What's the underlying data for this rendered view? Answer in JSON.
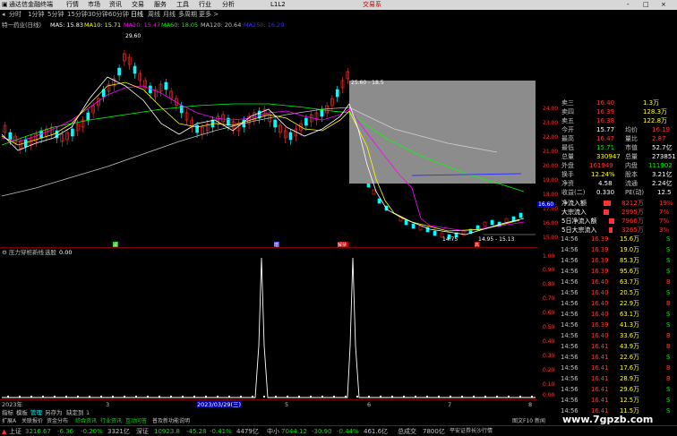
{
  "titlebar": {
    "app_name": "通达信金融终端",
    "menus": [
      "行情",
      "市场",
      "资讯",
      "交易",
      "服务",
      "工具",
      "行业",
      "分析"
    ],
    "title_center": "L1L2",
    "trade_button": "交易系",
    "window_controls": [
      "-",
      "□",
      "×"
    ]
  },
  "menubar": {
    "periods": [
      "分时",
      "1分钟",
      "5分钟",
      "15分钟",
      "30分钟",
      "60分钟",
      "日线",
      "周线",
      "月线",
      "多周期",
      "更多 >"
    ],
    "active_index": 6
  },
  "chart_info": {
    "stock": "特一药业(日线)",
    "ma5": "MA5: 15.83",
    "ma10": "MA10: 15.71",
    "ma20": "MA20: 15.47",
    "ma60": "MA60: 18.05",
    "ma120": "MA120: 20.64",
    "extra": "MA250: 16.29"
  },
  "main_chart": {
    "peak_label": "29.60",
    "range_label": "25.60 - 18.5",
    "low_label1": "14.75",
    "low_label2": "14.95 - 15.13",
    "event_markers": [
      "减",
      "增",
      "解禁",
      "高"
    ],
    "y_ticks": [
      "24.00",
      "23.00",
      "22.00",
      "21.00",
      "20.00",
      "19.00",
      "18.00",
      "17.00",
      "16.00",
      "15.00"
    ],
    "price_box": "16.60"
  },
  "sub_panel": {
    "title": "压力穿桩新线",
    "option": "选股",
    "value": "0.00",
    "y_ticks": [
      "1.00",
      "0.90",
      "0.80",
      "0.70",
      "0.60",
      "0.50",
      "0.40",
      "0.30",
      "0.20",
      "0.10",
      "0.00"
    ]
  },
  "time_axis": {
    "labels": [
      "2023年",
      "3",
      "2023/03/29(三)",
      "5",
      "6",
      "7",
      "8"
    ]
  },
  "tool_row": {
    "items": [
      "指标",
      "模板",
      "管理",
      "另存为",
      "缺定到",
      "1"
    ]
  },
  "bottom_tabs": {
    "items": [
      "扩展A",
      "关联报价",
      "资金分布",
      "综合资讯",
      "行业资讯",
      "互动问答",
      "普及新功能说明"
    ],
    "right_label": "图文F10 新闻"
  },
  "quote": {
    "sell_rows": [
      {
        "label": "卖三",
        "price": "16.40",
        "vol": "1.3万"
      },
      {
        "label": "卖四",
        "price": "16.39",
        "vol": "128.3万"
      },
      {
        "label": "卖五",
        "price": "16.38",
        "vol": "122.8万"
      }
    ],
    "stats": [
      {
        "l1": "今开",
        "v1": "15.77",
        "l2": "均价",
        "v2": "16.19"
      },
      {
        "l1": "最高",
        "v1": "16.47",
        "l2": "量比",
        "v2": "2.87"
      },
      {
        "l1": "最低",
        "v1": "15.71",
        "l2": "市值",
        "v2": "52.7亿"
      },
      {
        "l1": "总量",
        "v1": "330947",
        "l2": "总量",
        "v2": "273851"
      },
      {
        "l1": "外盘",
        "v1": "161949",
        "l2": "内盘",
        "v2": "111902"
      },
      {
        "l1": "换手",
        "v1": "12.24%",
        "l2": "股本",
        "v2": "3.21亿"
      },
      {
        "l1": "净资",
        "v1": "4.58",
        "l2": "流通",
        "v2": "2.24亿"
      },
      {
        "l1": "收益(二)",
        "v1": "0.330",
        "l2": "PE(动)",
        "v2": "12.5"
      }
    ],
    "flows": [
      {
        "label": "净流入额",
        "value": "8212万",
        "pct": "19%"
      },
      {
        "label": "大宗流入",
        "value": "2995万",
        "pct": "7%"
      },
      {
        "label": "5日净流入额",
        "value": "7966万",
        "pct": "7%"
      },
      {
        "label": "5日大宗流入",
        "value": "3265万",
        "pct": "3%"
      }
    ],
    "ticks": [
      {
        "time": "14:56",
        "price": "16.39",
        "vol": "15.6万",
        "flag": "S"
      },
      {
        "time": "14:56",
        "price": "16.39",
        "vol": "19.0万",
        "flag": "S"
      },
      {
        "time": "14:56",
        "price": "16.39",
        "vol": "85.3万",
        "flag": "S"
      },
      {
        "time": "14:56",
        "price": "16.39",
        "vol": "95.6万",
        "flag": "S"
      },
      {
        "time": "14:56",
        "price": "16.40",
        "vol": "63.7万",
        "flag": "B"
      },
      {
        "time": "14:56",
        "price": "16.40",
        "vol": "20.5万",
        "flag": "S"
      },
      {
        "time": "14:56",
        "price": "16.40",
        "vol": "22.9万",
        "flag": "B"
      },
      {
        "time": "14:56",
        "price": "16.40",
        "vol": "63.1万",
        "flag": "S"
      },
      {
        "time": "14:56",
        "price": "16.39",
        "vol": "41.3万",
        "flag": "S"
      },
      {
        "time": "14:56",
        "price": "16.40",
        "vol": "33.6万",
        "flag": "B"
      },
      {
        "time": "14:56",
        "price": "16.41",
        "vol": "43.9万",
        "flag": "B"
      },
      {
        "time": "14:56",
        "price": "16.41",
        "vol": "22.6万",
        "flag": "S"
      },
      {
        "time": "14:56",
        "price": "16.41",
        "vol": "17.6万",
        "flag": "B"
      },
      {
        "time": "14:56",
        "price": "16.41",
        "vol": "28.9万",
        "flag": "B"
      },
      {
        "time": "14:56",
        "price": "16.41",
        "vol": "29.6万",
        "flag": "S"
      },
      {
        "time": "14:56",
        "price": "16.41",
        "vol": "12.5万",
        "flag": "S"
      },
      {
        "time": "14:56",
        "price": "16.41",
        "vol": "11.5万",
        "flag": "S"
      }
    ]
  },
  "status": {
    "sh_label": "上证",
    "sh_value": "3216.67",
    "sh_chg": "-6.36",
    "sh_pct": "-0.20%",
    "sh_amt": "3321亿",
    "sz_label": "深证",
    "sz_value": "10923.8",
    "sz_chg": "-45.28",
    "sz_pct": "-0.41%",
    "sz_amt": "4479亿",
    "zx_label": "中小",
    "zx_value": "7044.12",
    "zx_chg": "-30.90",
    "zx_pct": "-0.44%",
    "zx_amt": "461.6亿",
    "total_label": "总成交",
    "total_amt": "7800亿",
    "broker": "平安证券长沙行情"
  },
  "watermark": "www.7gpzb.com",
  "colors": {
    "up": "#ff3232",
    "down": "#00ffff",
    "ma5": "#ffffff",
    "ma10": "#ffff00",
    "ma20": "#ff00ff",
    "ma60": "#00ff00",
    "ma120": "#c0c0c0",
    "volume_line": "#3030ff",
    "background": "#000000"
  }
}
